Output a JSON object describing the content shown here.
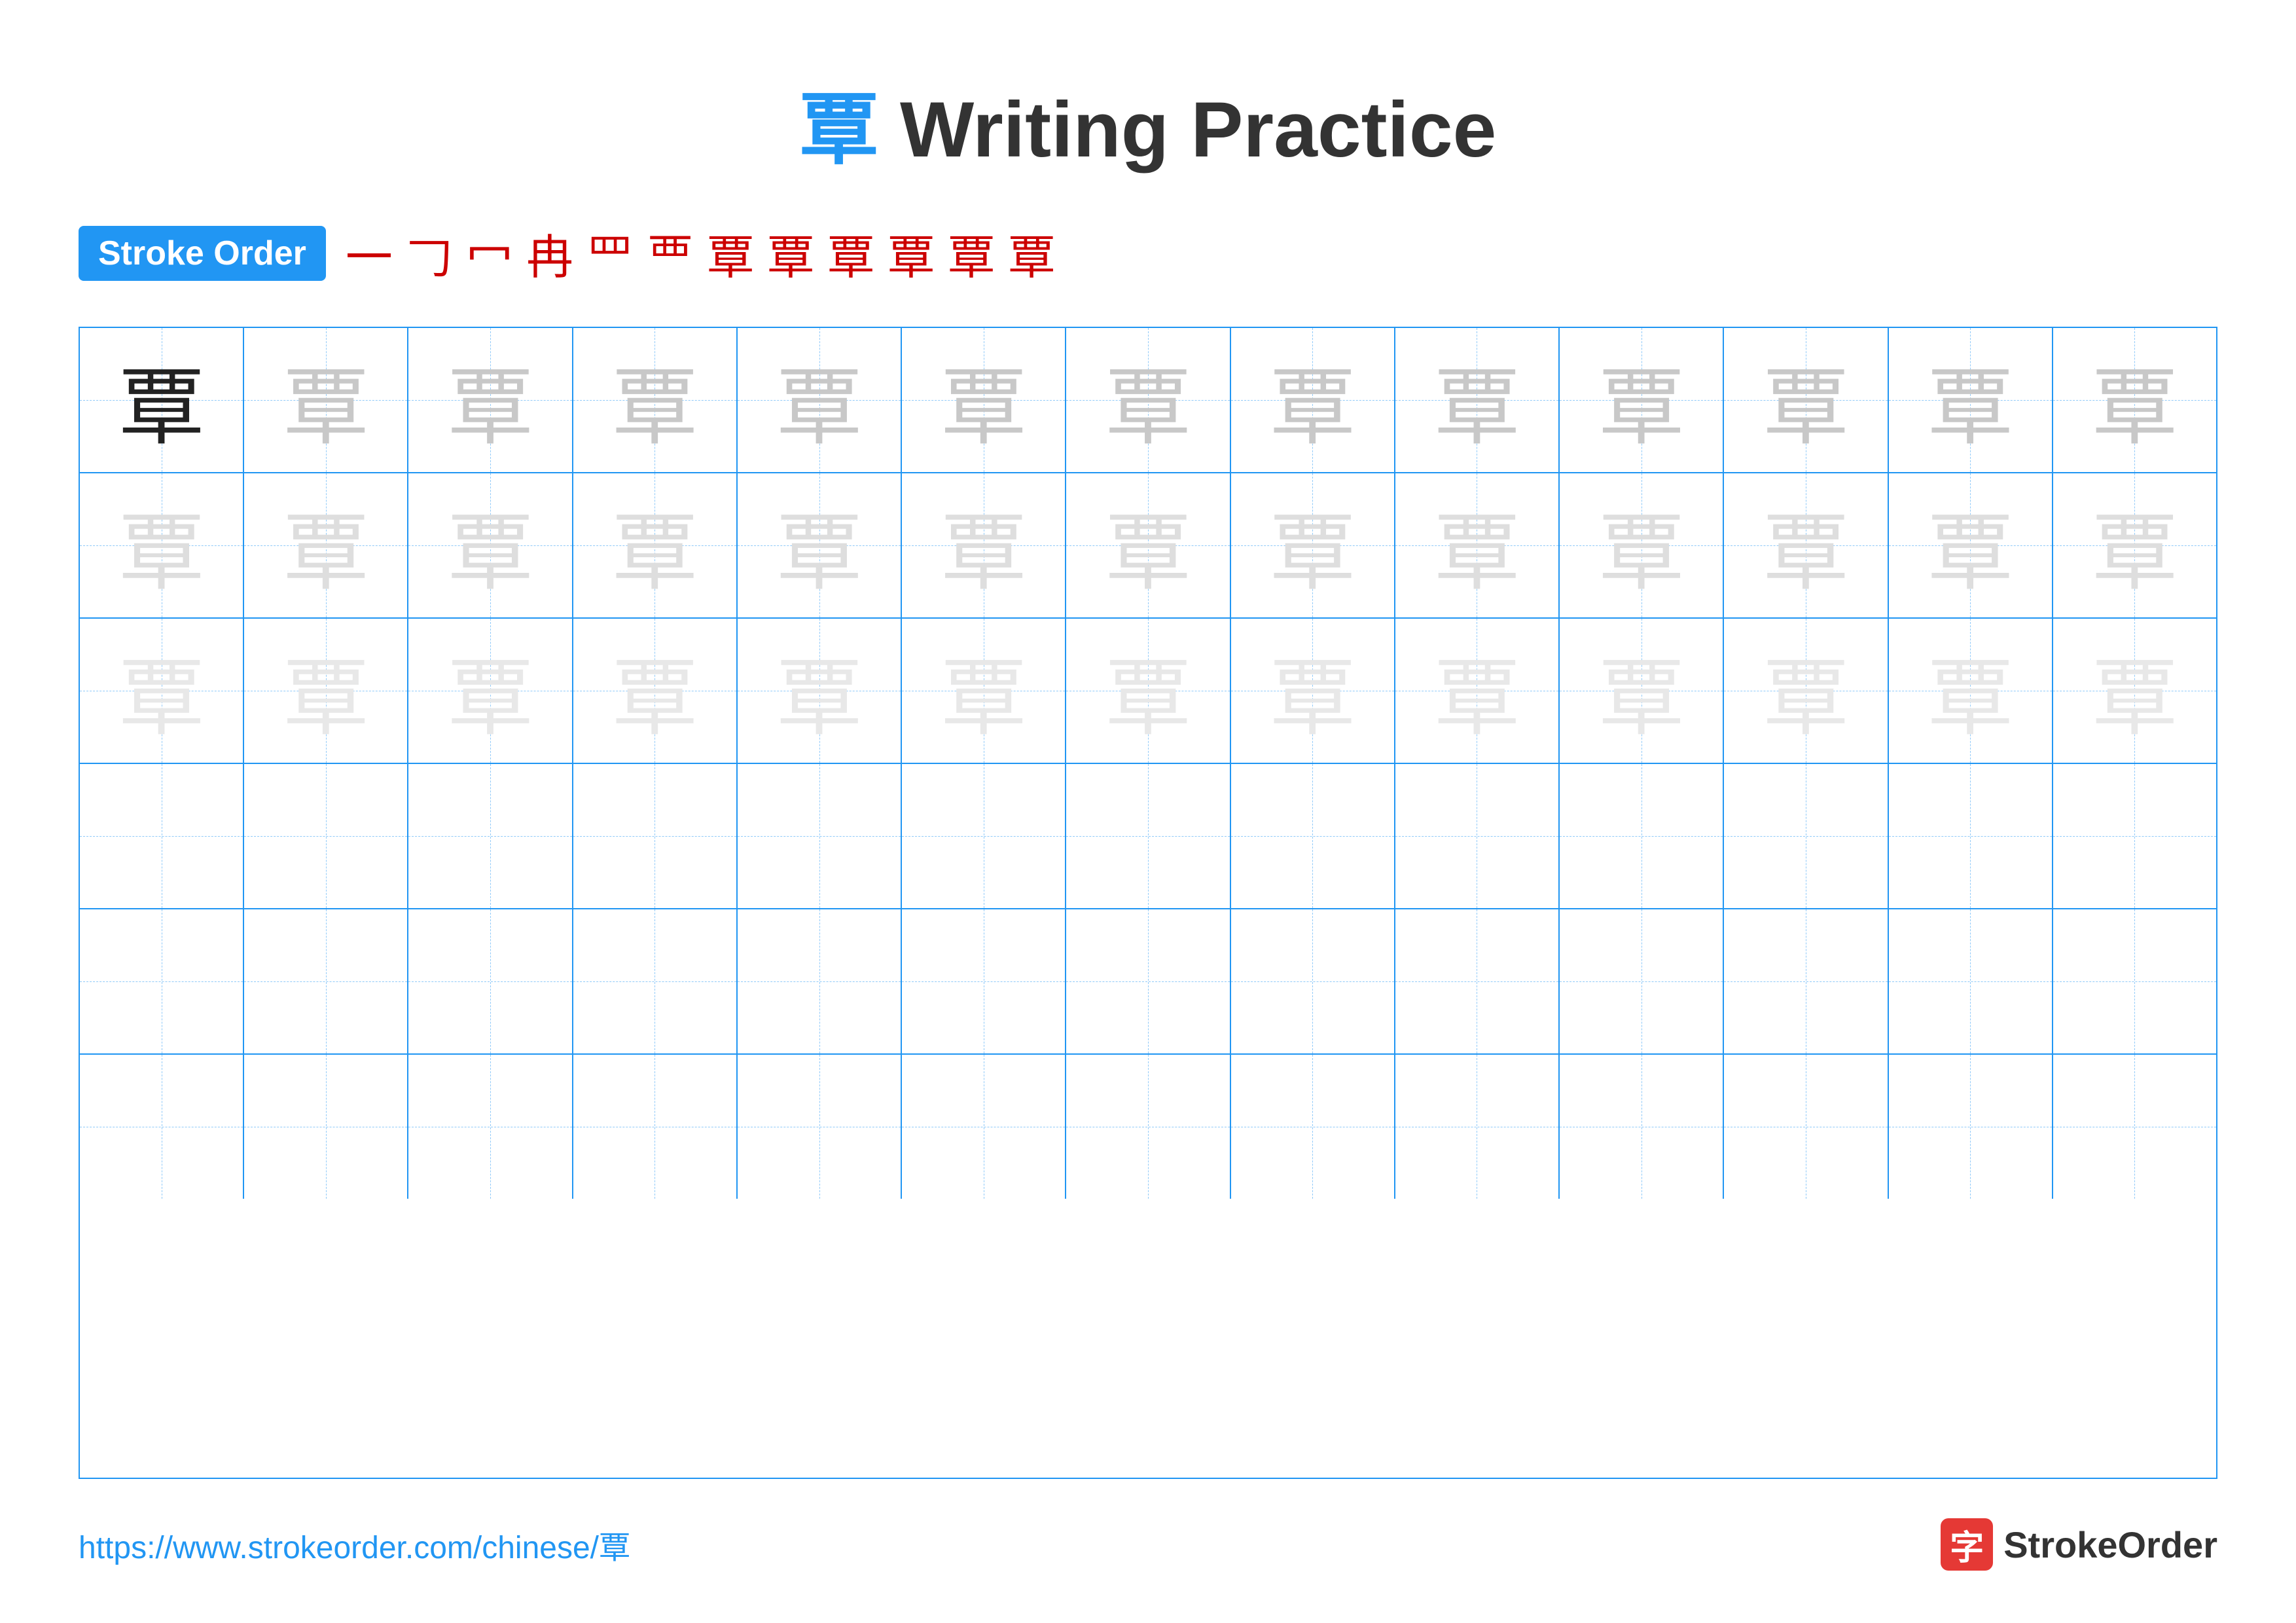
{
  "title": {
    "char": "覃",
    "text": " Writing Practice"
  },
  "stroke_order": {
    "badge_label": "Stroke Order",
    "strokes": [
      "一",
      "𠃌",
      "冖",
      "冉",
      "罒",
      "覀",
      "覃⁻",
      "覃⁼",
      "覃⁽",
      "曺",
      "覃̲",
      "覃"
    ]
  },
  "grid": {
    "rows": 6,
    "cols": 13,
    "char": "覃",
    "row_shades": [
      "dark",
      "medium",
      "light",
      "empty",
      "empty",
      "empty"
    ]
  },
  "footer": {
    "url": "https://www.strokeorder.com/chinese/覃",
    "logo_char": "字",
    "logo_text": "StrokeOrder"
  }
}
